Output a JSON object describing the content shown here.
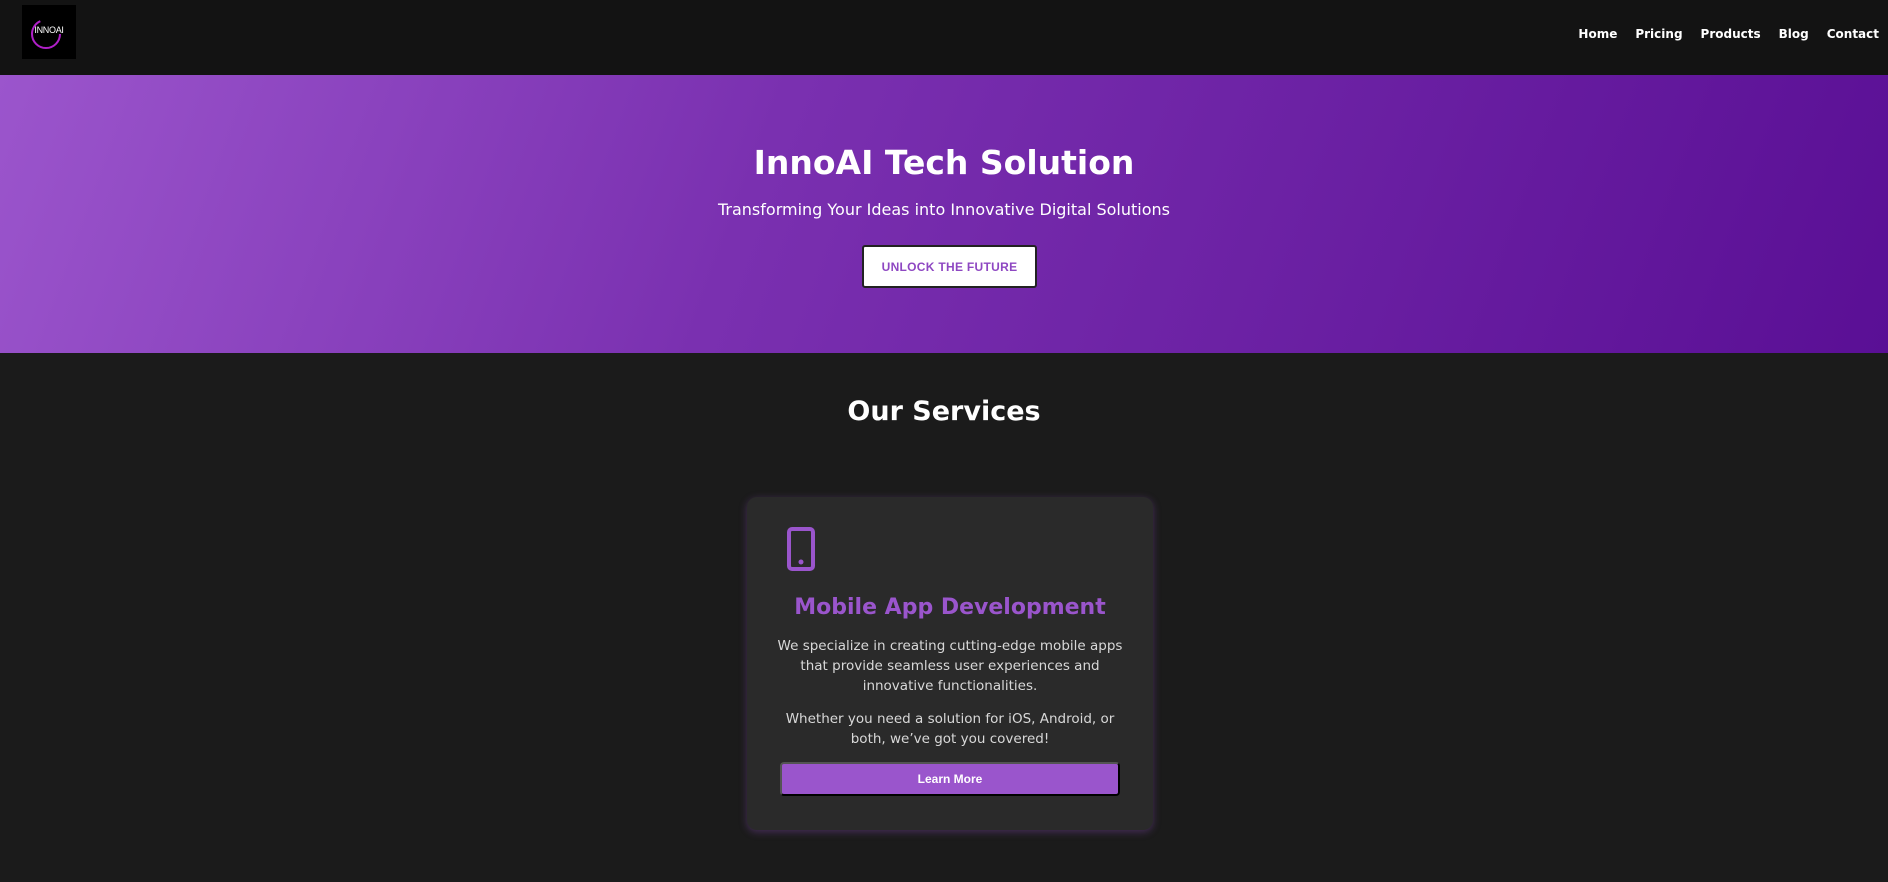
{
  "header": {
    "logo_text": "INNOAI",
    "nav": [
      {
        "label": "Home"
      },
      {
        "label": "Pricing"
      },
      {
        "label": "Products"
      },
      {
        "label": "Blog"
      },
      {
        "label": "Contact"
      }
    ]
  },
  "hero": {
    "title": "InnoAI Tech Solution",
    "subtitle": "Transforming Your Ideas into Innovative Digital Solutions",
    "cta_label": "UNLOCK THE FUTURE"
  },
  "services": {
    "title": "Our Services",
    "cards": [
      {
        "icon": "mobile-phone-icon",
        "title": "Mobile App Development",
        "paragraph_1": "We specialize in creating cutting-edge mobile apps that provide seamless user experiences and innovative functionalities.",
        "paragraph_2": "Whether you need a solution for iOS, Android, or both, we’ve got you covered!",
        "button_label": "Learn More"
      }
    ]
  },
  "colors": {
    "accent": "#9a55cc",
    "navbar_bg": "#131313",
    "page_bg": "#1b1b1b",
    "card_bg": "#2a2a2a",
    "hero_gradient_start": "#9b55cc",
    "hero_gradient_end": "#5a0f95"
  }
}
